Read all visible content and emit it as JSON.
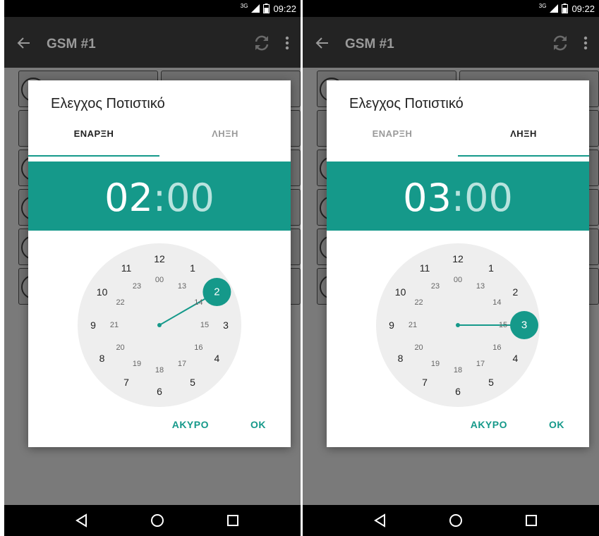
{
  "colors": {
    "accent": "#15998a",
    "accent_light": "#b8e3de",
    "scrim": "#7a7a7a"
  },
  "screens": [
    {
      "status": {
        "network": "3G",
        "time": "09:22"
      },
      "app": {
        "title": "GSM #1",
        "back_icon": "back-arrow-icon",
        "refresh_icon": "refresh-icon",
        "menu_icon": "more-vert-icon"
      },
      "dialog": {
        "title": "Ελεγχος Ποτιστικό",
        "tabs": [
          {
            "label": "ΕΝΑΡΞΗ",
            "active": true
          },
          {
            "label": "ΛΗΞΗ",
            "active": false
          }
        ],
        "time": {
          "hours": "02",
          "separator": ":",
          "minutes": "00"
        },
        "selected_hour": 2,
        "clock_outer": [
          "12",
          "1",
          "2",
          "3",
          "4",
          "5",
          "6",
          "7",
          "8",
          "9",
          "10",
          "11"
        ],
        "clock_inner": [
          "00",
          "13",
          "14",
          "15",
          "16",
          "17",
          "18",
          "19",
          "20",
          "21",
          "22",
          "23"
        ],
        "cancel_label": "ΑΚΥΡΟ",
        "ok_label": "OK"
      },
      "nav": {
        "back": "nav-back-icon",
        "home": "nav-home-icon",
        "recents": "nav-recents-icon"
      }
    },
    {
      "status": {
        "network": "3G",
        "time": "09:22"
      },
      "app": {
        "title": "GSM #1",
        "back_icon": "back-arrow-icon",
        "refresh_icon": "refresh-icon",
        "menu_icon": "more-vert-icon"
      },
      "dialog": {
        "title": "Ελεγχος Ποτιστικό",
        "tabs": [
          {
            "label": "ΕΝΑΡΞΗ",
            "active": false
          },
          {
            "label": "ΛΗΞΗ",
            "active": true
          }
        ],
        "time": {
          "hours": "03",
          "separator": ":",
          "minutes": "00"
        },
        "selected_hour": 3,
        "clock_outer": [
          "12",
          "1",
          "2",
          "3",
          "4",
          "5",
          "6",
          "7",
          "8",
          "9",
          "10",
          "11"
        ],
        "clock_inner": [
          "00",
          "13",
          "14",
          "15",
          "16",
          "17",
          "18",
          "19",
          "20",
          "21",
          "22",
          "23"
        ],
        "cancel_label": "ΑΚΥΡΟ",
        "ok_label": "OK"
      },
      "nav": {
        "back": "nav-back-icon",
        "home": "nav-home-icon",
        "recents": "nav-recents-icon"
      }
    }
  ]
}
